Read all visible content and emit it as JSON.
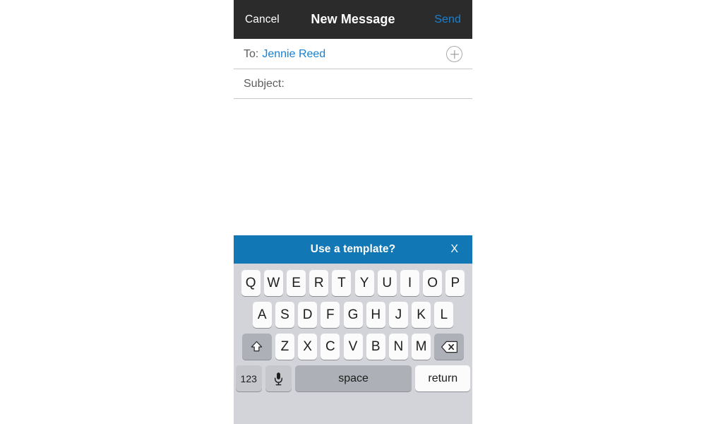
{
  "nav": {
    "cancel_label": "Cancel",
    "title": "New Message",
    "send_label": "Send"
  },
  "compose": {
    "to_label": "To:",
    "to_value": "Jennie Reed",
    "subject_label": "Subject:",
    "subject_value": "",
    "add_contact_icon": "plus-circle-icon"
  },
  "template_banner": {
    "text": "Use a template?",
    "close_label": "X",
    "background_color": "#1177b5"
  },
  "keyboard": {
    "row1": [
      "Q",
      "W",
      "E",
      "R",
      "T",
      "Y",
      "U",
      "I",
      "O",
      "P"
    ],
    "row2": [
      "A",
      "S",
      "D",
      "F",
      "G",
      "H",
      "J",
      "K",
      "L"
    ],
    "row3": [
      "Z",
      "X",
      "C",
      "V",
      "B",
      "N",
      "M"
    ],
    "shift_icon": "shift-arrow-icon",
    "backspace_icon": "backspace-icon",
    "numbers_label": "123",
    "mic_icon": "microphone-icon",
    "space_label": "space",
    "return_label": "return"
  },
  "colors": {
    "nav_background": "#2b2b2b",
    "accent_blue": "#1581d6",
    "banner_blue": "#1177b5",
    "keyboard_background": "#d2d4d9",
    "key_white": "#fbfbfb",
    "key_gray": "#aeb0b7"
  }
}
